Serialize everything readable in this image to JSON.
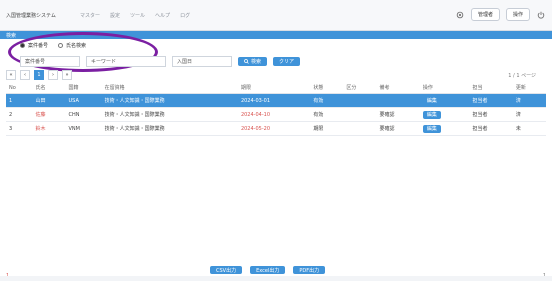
{
  "app": {
    "brand": "入国管理業務システム",
    "nav": [
      "マスター",
      "設定",
      "ツール",
      "ヘルプ",
      "ログ"
    ]
  },
  "top_right": {
    "user_label": "管理者",
    "settings_label": "操作"
  },
  "blue_bar": {
    "label": "検索"
  },
  "radios": [
    {
      "label": "案件番号",
      "checked": true
    },
    {
      "label": "氏名検索",
      "checked": false
    }
  ],
  "search": {
    "field1_value": "案件番号",
    "field2_placeholder": "キーワード",
    "field3_label": "入国日",
    "button_search": "検索",
    "button_clear": "クリア"
  },
  "pagination": {
    "current": "1",
    "info": "1 / 1 ページ",
    "count": "全 3 件"
  },
  "table": {
    "headers": [
      "No",
      "氏名",
      "国籍",
      "在留資格",
      "期限",
      "状態",
      "区分",
      "備考",
      "操作",
      "担当",
      "更新"
    ],
    "rows": [
      [
        "1",
        "山田",
        "USA",
        "技術・人文知識・国際業務",
        "2024-03-01",
        "有効",
        "",
        "",
        "編集",
        "担当者",
        "済"
      ],
      [
        "2",
        "佐藤",
        "CHN",
        "技術・人文知識・国際業務",
        "2024-04-10",
        "有効",
        "",
        "要確認",
        "編集",
        "担当者",
        "済"
      ],
      [
        "3",
        "鈴木",
        "VNM",
        "技術・人文知識・国際業務",
        "2024-05-20",
        "期限",
        "",
        "要確認",
        "編集",
        "担当者",
        "未"
      ]
    ]
  },
  "footer": {
    "buttons": [
      "CSV出力",
      "Excel出力",
      "PDF出力"
    ],
    "left_text": "1",
    "right_text": "1"
  },
  "colors": {
    "accent": "#3f93d9",
    "highlight": "#7b1fa2",
    "warning": "#d9534f"
  }
}
